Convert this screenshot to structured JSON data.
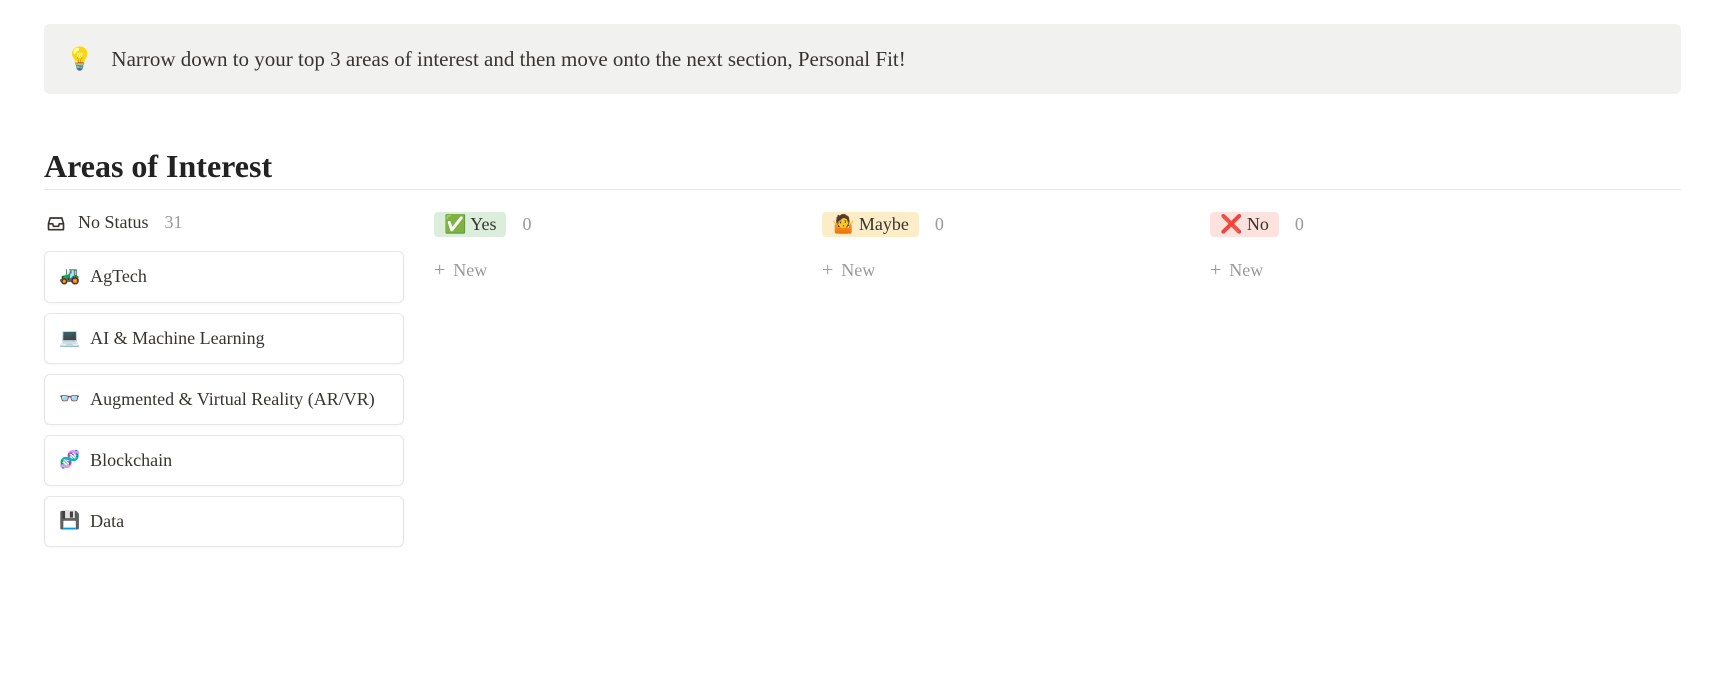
{
  "callout": {
    "icon": "💡",
    "text": "Narrow down to your top 3 areas of interest and then move onto the next section, Personal Fit!"
  },
  "heading": "Areas of Interest",
  "columns": {
    "no_status": {
      "label": "No Status",
      "count": "31",
      "cards": [
        {
          "emoji": "🚜",
          "title": "AgTech"
        },
        {
          "emoji": "💻",
          "title": "AI & Machine Learning"
        },
        {
          "emoji": "👓",
          "title": "Augmented & Virtual Reality (AR/VR)"
        },
        {
          "emoji": "🧬",
          "title": "Blockchain"
        },
        {
          "emoji": "💾",
          "title": "Data"
        }
      ]
    },
    "yes": {
      "icon": "✅",
      "label": "Yes",
      "count": "0",
      "new_label": "New"
    },
    "maybe": {
      "icon": "🤷",
      "label": "Maybe",
      "count": "0",
      "new_label": "New"
    },
    "no": {
      "icon": "❌",
      "label": "No",
      "count": "0",
      "new_label": "New"
    }
  }
}
